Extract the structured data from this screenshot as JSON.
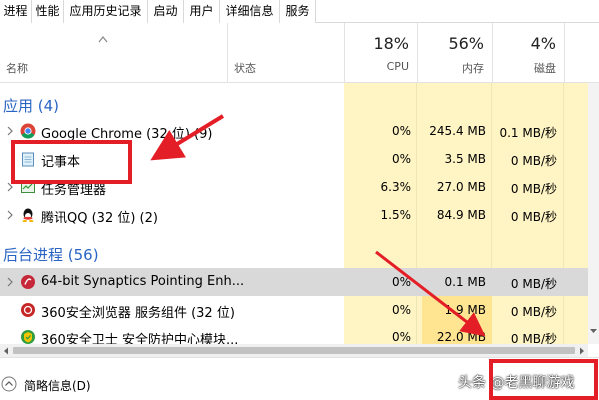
{
  "tabs": [
    {
      "label": "进程",
      "active": true
    },
    {
      "label": "性能",
      "active": false
    },
    {
      "label": "应用历史记录",
      "active": false
    },
    {
      "label": "启动",
      "active": false
    },
    {
      "label": "用户",
      "active": false
    },
    {
      "label": "详细信息",
      "active": false
    },
    {
      "label": "服务",
      "active": false
    }
  ],
  "columns": {
    "name": "名称",
    "status": "状态",
    "cpu": {
      "percent": "18%",
      "label": "CPU"
    },
    "memory": {
      "percent": "56%",
      "label": "内存"
    },
    "disk": {
      "percent": "4%",
      "label": "磁盘"
    }
  },
  "groups": {
    "apps": "应用 (4)",
    "background": "后台进程 (56)"
  },
  "processes": [
    {
      "name": "Google Chrome (32 位) (9)",
      "cpu": "0%",
      "memory": "245.4 MB",
      "disk": "0.1 MB/秒",
      "icon": "chrome-icon",
      "expandable": true
    },
    {
      "name": "记事本",
      "cpu": "0%",
      "memory": "3.5 MB",
      "disk": "0 MB/秒",
      "icon": "notepad-icon",
      "expandable": false
    },
    {
      "name": "任务管理器",
      "cpu": "6.3%",
      "memory": "27.0 MB",
      "disk": "0 MB/秒",
      "icon": "task-manager-icon",
      "expandable": true
    },
    {
      "name": "腾讯QQ (32 位) (2)",
      "cpu": "1.5%",
      "memory": "84.9 MB",
      "disk": "0 MB/秒",
      "icon": "qq-icon",
      "expandable": true
    },
    {
      "name": "64-bit Synaptics Pointing Enh...",
      "cpu": "0%",
      "memory": "0.1 MB",
      "disk": "0 MB/秒",
      "icon": "synaptics-icon",
      "expandable": true,
      "selected": true
    },
    {
      "name": "360安全浏览器 服务组件 (32 位)",
      "cpu": "0%",
      "memory": "1.9 MB",
      "disk": "0 MB/秒",
      "icon": "360-browser-icon",
      "expandable": false
    },
    {
      "name": "360安全卫士 安全防护中心模块...",
      "cpu": "0%",
      "memory": "22.0 MB",
      "disk": "0 MB/秒",
      "icon": "360-safe-icon",
      "expandable": false
    }
  ],
  "footer": {
    "brief_label": "简略信息(D)",
    "watermark": "头条 @老黑聊游戏"
  },
  "colors": {
    "accent": "#2964c3",
    "highlight": "#fff4c4",
    "annotation": "#e41e26"
  }
}
